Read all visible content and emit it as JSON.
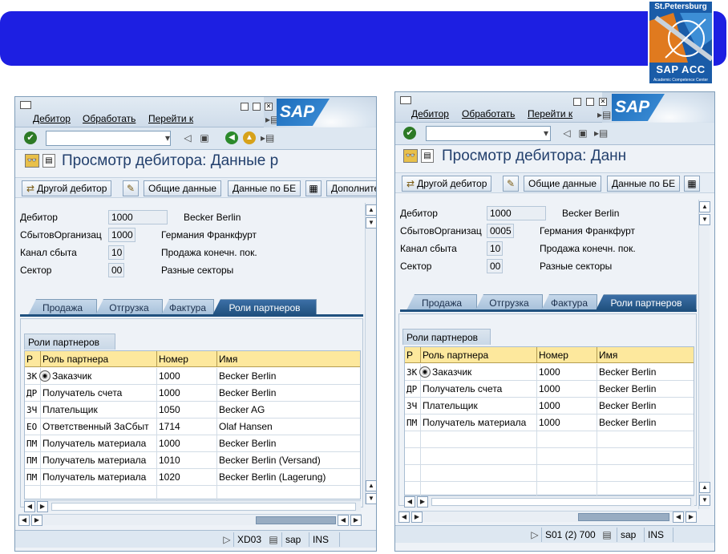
{
  "logo": {
    "city": "St.Petersburg",
    "brand": "SAP ACC",
    "tagline": "Academic Competence Center"
  },
  "windows": [
    {
      "menu": {
        "debtor": "Дебитор",
        "edit": "Обработать",
        "goto": "Перейти к"
      },
      "sap_logo": "SAP",
      "title": "Просмотр дебитора: Данные р",
      "toolbar": {
        "other_debtor": "Другой дебитор",
        "general_data": "Общие данные",
        "company_data": "Данные по БЕ",
        "more": "Дополните"
      },
      "fields": [
        {
          "label": "Дебитор",
          "value": "1000",
          "desc": "Becker Berlin"
        },
        {
          "label": "СбытовОрганизац",
          "value": "1000",
          "desc": "Германия Франкфурт"
        },
        {
          "label": "Канал сбыта",
          "value": "10",
          "desc": "Продажа конечн. пок."
        },
        {
          "label": "Сектор",
          "value": "00",
          "desc": "Разные секторы"
        }
      ],
      "tabs": [
        "Продажа",
        "Отгрузка",
        "Фактура",
        "Роли партнеров"
      ],
      "panel_title": "Роли партнеров",
      "columns": [
        "P",
        "Роль партнера",
        "Номер",
        "Имя"
      ],
      "rows": [
        [
          "ЗК",
          "Заказчик",
          "1000",
          "Becker Berlin"
        ],
        [
          "ДР",
          "Получатель счета",
          "1000",
          "Becker Berlin"
        ],
        [
          "ЗЧ",
          "Плательщик",
          "1050",
          "Becker AG"
        ],
        [
          "ЕО",
          "Ответственный ЗаСбыт",
          "1714",
          "Olaf Hansen"
        ],
        [
          "ПМ",
          "Получатель материала",
          "1000",
          "Becker Berlin"
        ],
        [
          "ПМ",
          "Получатель материала",
          "1010",
          "Becker Berlin (Versand)"
        ],
        [
          "ПМ",
          "Получатель материала",
          "1020",
          "Becker Berlin (Lagerung)"
        ]
      ],
      "status": {
        "tcode": "XD03",
        "system": "sap",
        "mode": "INS"
      }
    },
    {
      "menu": {
        "debtor": "Дебитор",
        "edit": "Обработать",
        "goto": "Перейти к"
      },
      "sap_logo": "SAP",
      "title": "Просмотр дебитора: Данн",
      "toolbar": {
        "other_debtor": "Другой дебитор",
        "general_data": "Общие данные",
        "company_data": "Данные по БЕ"
      },
      "fields": [
        {
          "label": "Дебитор",
          "value": "1000",
          "desc": "Becker Berlin"
        },
        {
          "label": "СбытовОрганизац",
          "value": "0005",
          "desc": "Германия Франкфурт"
        },
        {
          "label": "Канал сбыта",
          "value": "10",
          "desc": "Продажа конечн. пок."
        },
        {
          "label": "Сектор",
          "value": "00",
          "desc": "Разные секторы"
        }
      ],
      "tabs": [
        "Продажа",
        "Отгрузка",
        "Фактура",
        "Роли партнеров"
      ],
      "panel_title": "Роли партнеров",
      "columns": [
        "P",
        "Роль партнера",
        "Номер",
        "Имя"
      ],
      "rows": [
        [
          "ЗК",
          "Заказчик",
          "1000",
          "Becker Berlin"
        ],
        [
          "ДР",
          "Получатель счета",
          "1000",
          "Becker Berlin"
        ],
        [
          "ЗЧ",
          "Плательщик",
          "1000",
          "Becker Berlin"
        ],
        [
          "ПМ",
          "Получатель материала",
          "1000",
          "Becker Berlin"
        ]
      ],
      "status": {
        "tcode": "S01 (2) 700",
        "system": "sap",
        "mode": "INS"
      }
    }
  ]
}
